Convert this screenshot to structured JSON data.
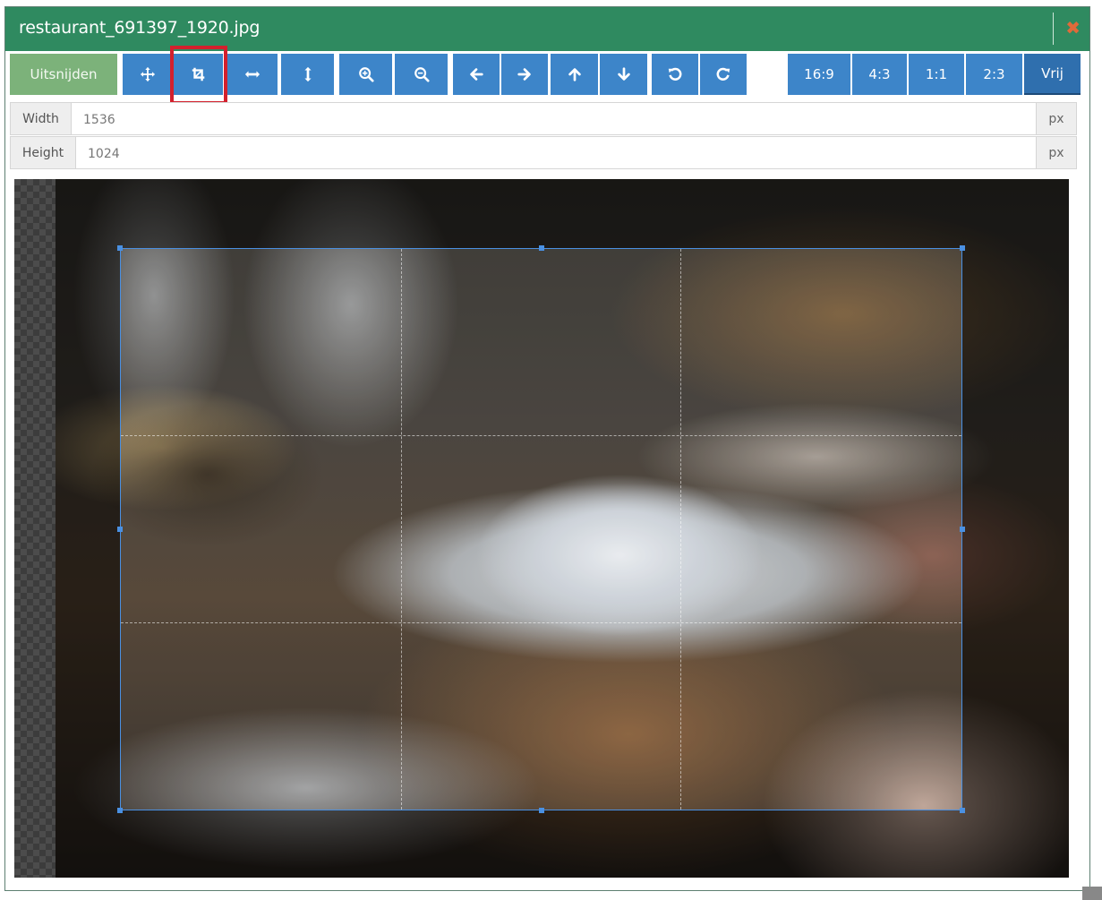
{
  "window": {
    "title": "restaurant_691397_1920.jpg",
    "close_icon": "times-icon",
    "colors": {
      "header": "#2f8a60",
      "close": "#e06a3a",
      "button": "#3d85c9",
      "crop_button": "#7cb27a",
      "highlight": "#d3202d"
    }
  },
  "toolbar": {
    "crop_label": "Uitsnijden",
    "tools": [
      {
        "name": "move",
        "icon": "arrows-move-icon"
      },
      {
        "name": "crop",
        "icon": "crop-icon",
        "highlighted": true
      },
      {
        "name": "flip-horizontal",
        "icon": "arrows-horizontal-icon"
      },
      {
        "name": "flip-vertical",
        "icon": "arrows-vertical-icon"
      },
      {
        "name": "zoom-in",
        "icon": "zoom-in-icon"
      },
      {
        "name": "zoom-out",
        "icon": "zoom-out-icon"
      },
      {
        "name": "move-left",
        "icon": "arrow-left-icon"
      },
      {
        "name": "move-right",
        "icon": "arrow-right-icon"
      },
      {
        "name": "move-up",
        "icon": "arrow-up-icon"
      },
      {
        "name": "move-down",
        "icon": "arrow-down-icon"
      },
      {
        "name": "rotate-left",
        "icon": "rotate-left-icon"
      },
      {
        "name": "rotate-right",
        "icon": "rotate-right-icon"
      }
    ],
    "ratios": [
      {
        "label": "16:9",
        "active": false
      },
      {
        "label": "4:3",
        "active": false
      },
      {
        "label": "1:1",
        "active": false
      },
      {
        "label": "2:3",
        "active": false
      },
      {
        "label": "Vrij",
        "active": true
      }
    ]
  },
  "dimensions": {
    "width_label": "Width",
    "width_value": "1536",
    "height_label": "Height",
    "height_value": "1024",
    "unit": "px"
  },
  "image": {
    "description": "Restaurant table with plated fish dish, wine glasses and bread basket",
    "crop_area": "free selection active"
  }
}
